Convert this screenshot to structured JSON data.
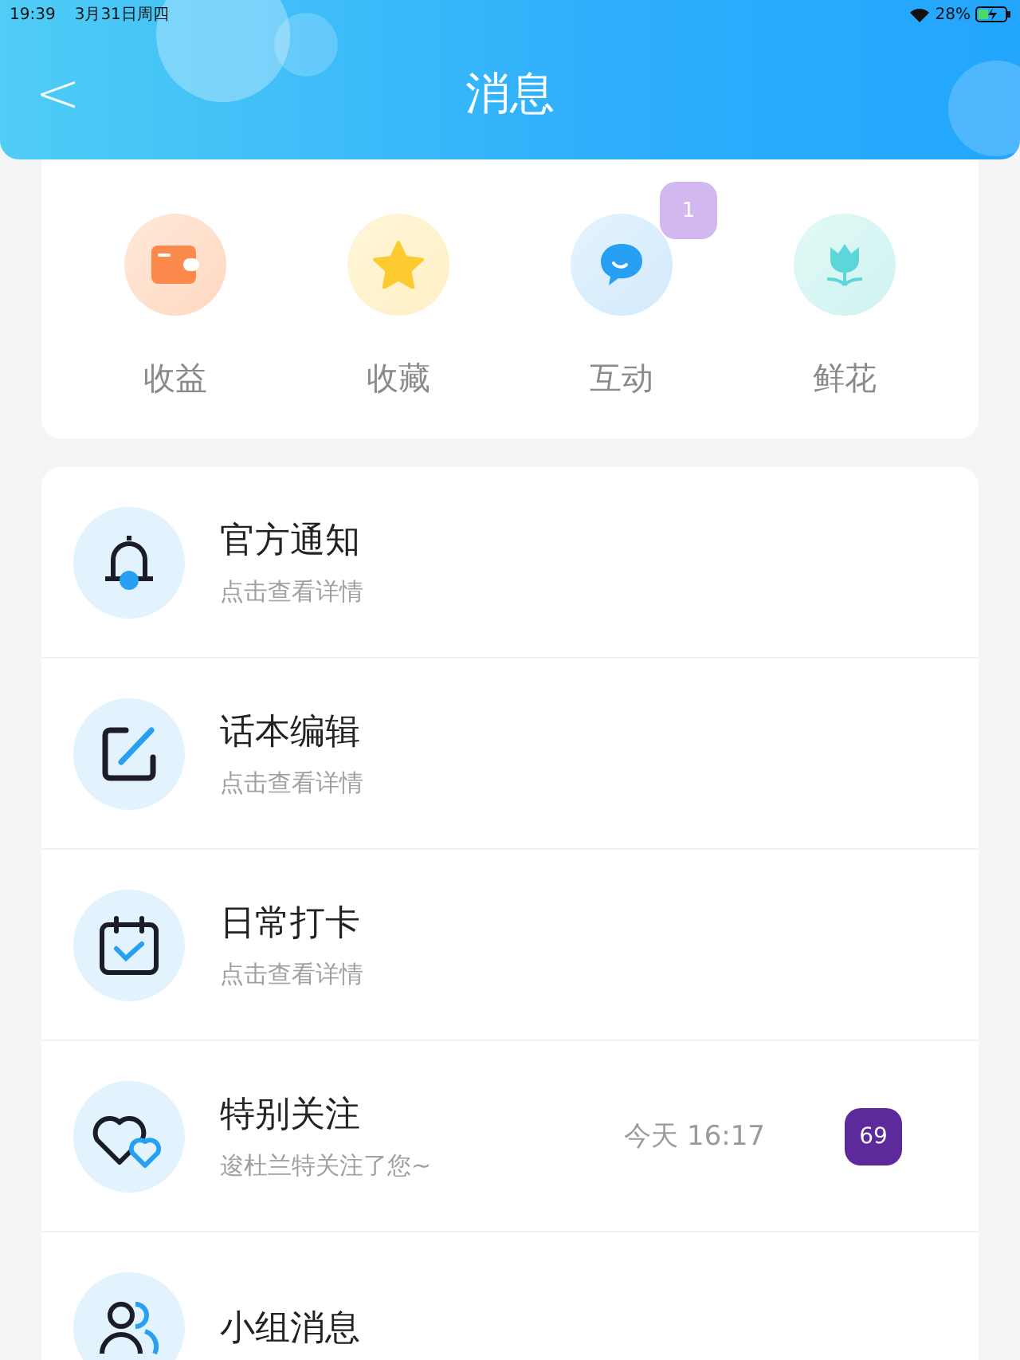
{
  "status_bar": {
    "time": "19:39",
    "date": "3月31日周四",
    "battery": "28%"
  },
  "header": {
    "back": "<",
    "title": "消息"
  },
  "categories": [
    {
      "label": "收益"
    },
    {
      "label": "收藏"
    },
    {
      "label": "互动",
      "badge": "1"
    },
    {
      "label": "鲜花"
    }
  ],
  "messages": [
    {
      "title": "官方通知",
      "subtitle": "点击查看详情"
    },
    {
      "title": "话本编辑",
      "subtitle": "点击查看详情"
    },
    {
      "title": "日常打卡",
      "subtitle": "点击查看详情"
    },
    {
      "title": "特别关注",
      "subtitle": "逡杜兰特关注了您~",
      "time": "今天 16:17",
      "badge": "69"
    },
    {
      "title": "小组消息"
    }
  ]
}
